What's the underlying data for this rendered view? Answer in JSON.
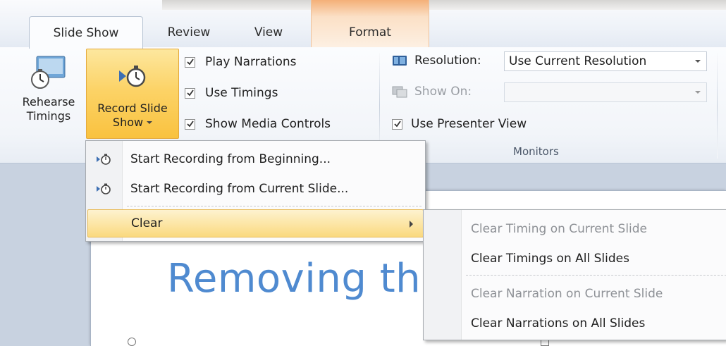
{
  "tabs": [
    {
      "label": "Slide Show",
      "active": true
    },
    {
      "label": "Review",
      "active": false
    },
    {
      "label": "View",
      "active": false
    },
    {
      "label": "Format",
      "active": false,
      "contextual": true
    }
  ],
  "ribbon": {
    "rehearse_timings": {
      "line1": "Rehearse",
      "line2": "Timings"
    },
    "record_slide_show": {
      "line1": "Record Slide",
      "line2": "Show"
    },
    "checkboxes": [
      {
        "label": "Play Narrations",
        "checked": true
      },
      {
        "label": "Use Timings",
        "checked": true
      },
      {
        "label": "Show Media Controls",
        "checked": true
      }
    ],
    "monitors": {
      "resolution_label": "Resolution:",
      "resolution_value": "Use Current Resolution",
      "show_on_label": "Show On:",
      "show_on_value": "",
      "presenter_view_label": "Use Presenter View",
      "presenter_view_checked": true,
      "group_label": "Monitors"
    }
  },
  "record_menu": {
    "items": [
      {
        "label": "Start Recording from Beginning...",
        "icon": "record-icon",
        "mnemonic": "S"
      },
      {
        "label": "Start Recording from Current Slide...",
        "icon": "record-icon",
        "mnemonic": "R"
      },
      {
        "label": "Clear",
        "icon": "",
        "mnemonic": "C",
        "has_submenu": true,
        "highlighted": true
      }
    ]
  },
  "clear_submenu": {
    "items": [
      {
        "label": "Clear Timing on Current Slide",
        "enabled": false
      },
      {
        "label": "Clear Timings on All Slides",
        "enabled": true
      },
      {
        "label": "Clear Narration on Current Slide",
        "enabled": false
      },
      {
        "label": "Clear Narrations on All Slides",
        "enabled": true
      }
    ]
  },
  "slide": {
    "title_fragment": "Removing th"
  },
  "colors": {
    "accent_highlight": "#fcd367",
    "slide_title": "#4f8ad0",
    "contextual_tab": "#f4b078"
  }
}
